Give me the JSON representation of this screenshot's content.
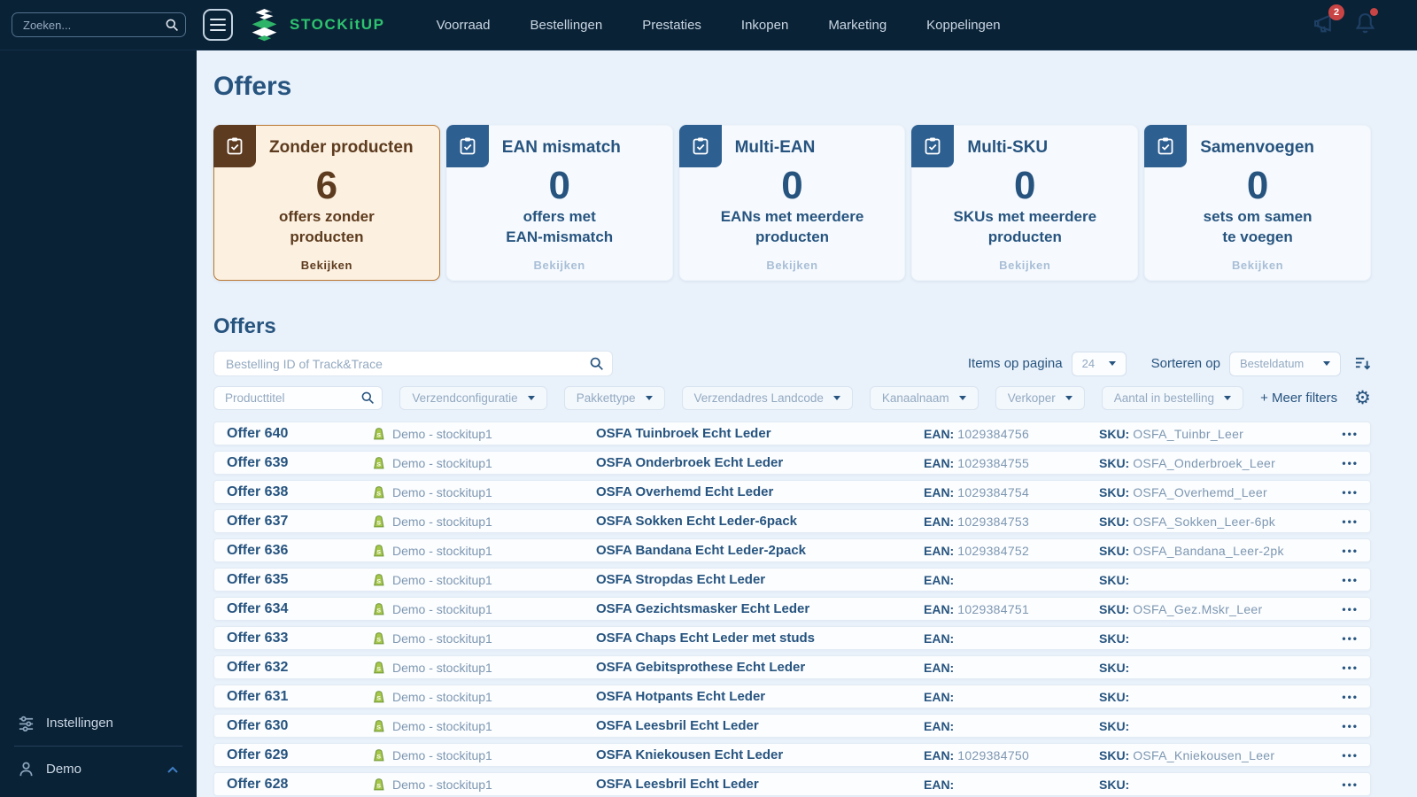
{
  "topbar": {
    "search_placeholder": "Zoeken...",
    "brand": "STOCKitUP",
    "nav_items": [
      "Voorraad",
      "Bestellingen",
      "Prestaties",
      "Inkopen",
      "Marketing",
      "Koppelingen"
    ],
    "announcements_badge": "2"
  },
  "sidebar": {
    "settings_label": "Instellingen",
    "user_name": "Demo"
  },
  "page": {
    "title": "Offers"
  },
  "colors": {
    "accent_green": "#2ec46f",
    "dark_navy": "#0a2236",
    "primary_blue": "#27547f",
    "active_brown": "#5d3b1e",
    "active_card_bg": "#fcf0e0",
    "badge_red": "#c94444"
  },
  "summary_cards": [
    {
      "title": "Zonder producten",
      "value": "6",
      "description": "offers zonder\nproducten",
      "action": "Bekijken",
      "theme": "active"
    },
    {
      "title": "EAN mismatch",
      "value": "0",
      "description": "offers met\nEAN-mismatch",
      "action": "Bekijken"
    },
    {
      "title": "Multi-EAN",
      "value": "0",
      "description": "EANs met meerdere\nproducten",
      "action": "Bekijken"
    },
    {
      "title": "Multi-SKU",
      "value": "0",
      "description": "SKUs met meerdere\nproducten",
      "action": "Bekijken"
    },
    {
      "title": "Samenvoegen",
      "value": "0",
      "description": "sets om samen\nte voegen",
      "action": "Bekijken"
    }
  ],
  "offers_section": {
    "title": "Offers",
    "search_placeholder": "Bestelling ID of Track&Trace",
    "items_per_page_label": "Items op pagina",
    "items_per_page_value": "24",
    "sort_label": "Sorteren op",
    "sort_value": "Besteldatum",
    "product_filter_placeholder": "Producttitel",
    "filter_dropdowns": [
      "Verzendconfiguratie",
      "Pakkettype",
      "Verzendadres Landcode",
      "Kanaalnaam",
      "Verkoper",
      "Aantal in bestelling"
    ],
    "more_filters_label": "+ Meer filters",
    "row_menu_icon": "•••",
    "gear_icon": "⚙"
  },
  "table": {
    "ean_label": "EAN:",
    "sku_label": "SKU:",
    "rows": [
      {
        "id": "Offer 640",
        "channel": "Demo - stockitup1",
        "product": "OSFA Tuinbroek Echt Leder",
        "ean": "1029384756",
        "sku": "OSFA_Tuinbr_Leer"
      },
      {
        "id": "Offer 639",
        "channel": "Demo - stockitup1",
        "product": "OSFA Onderbroek Echt Leder",
        "ean": "1029384755",
        "sku": "OSFA_Onderbroek_Leer"
      },
      {
        "id": "Offer 638",
        "channel": "Demo - stockitup1",
        "product": "OSFA Overhemd Echt Leder",
        "ean": "1029384754",
        "sku": "OSFA_Overhemd_Leer"
      },
      {
        "id": "Offer 637",
        "channel": "Demo - stockitup1",
        "product": "OSFA Sokken Echt Leder-6pack",
        "ean": "1029384753",
        "sku": "OSFA_Sokken_Leer-6pk"
      },
      {
        "id": "Offer 636",
        "channel": "Demo - stockitup1",
        "product": "OSFA Bandana Echt Leder-2pack",
        "ean": "1029384752",
        "sku": "OSFA_Bandana_Leer-2pk"
      },
      {
        "id": "Offer 635",
        "channel": "Demo - stockitup1",
        "product": "OSFA Stropdas Echt Leder",
        "ean": "",
        "sku": ""
      },
      {
        "id": "Offer 634",
        "channel": "Demo - stockitup1",
        "product": "OSFA Gezichtsmasker Echt Leder",
        "ean": "1029384751",
        "sku": "OSFA_Gez.Mskr_Leer"
      },
      {
        "id": "Offer 633",
        "channel": "Demo - stockitup1",
        "product": "OSFA Chaps Echt Leder met studs",
        "ean": "",
        "sku": ""
      },
      {
        "id": "Offer 632",
        "channel": "Demo - stockitup1",
        "product": "OSFA Gebitsprothese Echt Leder",
        "ean": "",
        "sku": ""
      },
      {
        "id": "Offer 631",
        "channel": "Demo - stockitup1",
        "product": "OSFA Hotpants Echt Leder",
        "ean": "",
        "sku": ""
      },
      {
        "id": "Offer 630",
        "channel": "Demo - stockitup1",
        "product": "OSFA Leesbril Echt Leder",
        "ean": "",
        "sku": ""
      },
      {
        "id": "Offer 629",
        "channel": "Demo - stockitup1",
        "product": "OSFA Kniekousen Echt Leder",
        "ean": "1029384750",
        "sku": "OSFA_Kniekousen_Leer"
      },
      {
        "id": "Offer 628",
        "channel": "Demo - stockitup1",
        "product": "OSFA Leesbril Echt Leder",
        "ean": "",
        "sku": ""
      }
    ]
  }
}
